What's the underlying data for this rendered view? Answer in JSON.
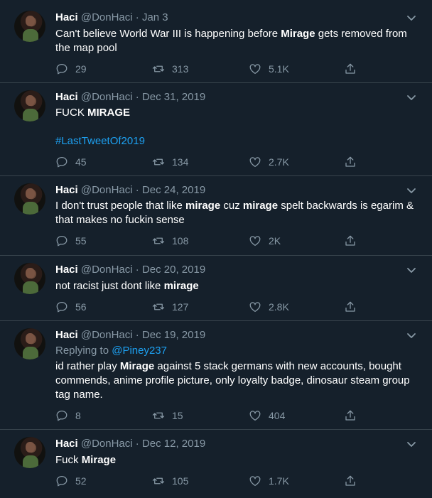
{
  "colors": {
    "background": "#15202b",
    "divider": "#38444d",
    "secondary_text": "#8899a6",
    "link": "#1da1f2"
  },
  "tweets": [
    {
      "name": "Haci",
      "meta": "@DonHaci · Jan 3",
      "text_parts": [
        "Can't believe World War III is happening before ",
        "Mirage",
        " gets removed from the map pool"
      ],
      "replies": "29",
      "retweets": "313",
      "likes": "5.1K"
    },
    {
      "name": "Haci",
      "meta": "@DonHaci · Dec 31, 2019",
      "text_parts": [
        "FUCK ",
        "MIRAGE"
      ],
      "hashtag": "#LastTweetOf2019",
      "replies": "45",
      "retweets": "134",
      "likes": "2.7K"
    },
    {
      "name": "Haci",
      "meta": "@DonHaci · Dec 24, 2019",
      "text_parts": [
        "I don't trust people that like ",
        "mirage",
        " cuz ",
        "mirage",
        " spelt backwards is egarim & that makes no fuckin sense"
      ],
      "replies": "55",
      "retweets": "108",
      "likes": "2K"
    },
    {
      "name": "Haci",
      "meta": "@DonHaci · Dec 20, 2019",
      "text_parts": [
        "not racist just dont like ",
        "mirage"
      ],
      "replies": "56",
      "retweets": "127",
      "likes": "2.8K"
    },
    {
      "name": "Haci",
      "meta": "@DonHaci · Dec 19, 2019",
      "replying_label": "Replying to ",
      "replying_handle": "@Piney237",
      "text_parts": [
        "id rather play ",
        "Mirage",
        " against 5 stack germans with new accounts, bought commends, anime profile picture, only loyalty badge, dinosaur steam group tag name."
      ],
      "replies": "8",
      "retweets": "15",
      "likes": "404"
    },
    {
      "name": "Haci",
      "meta": "@DonHaci · Dec 12, 2019",
      "text_parts": [
        "Fuck ",
        "Mirage"
      ],
      "replies": "52",
      "retweets": "105",
      "likes": "1.7K"
    }
  ],
  "icons": {
    "reply": "reply-icon",
    "retweet": "retweet-icon",
    "like": "like-icon",
    "share": "share-icon",
    "menu": "chevron-down-icon"
  }
}
